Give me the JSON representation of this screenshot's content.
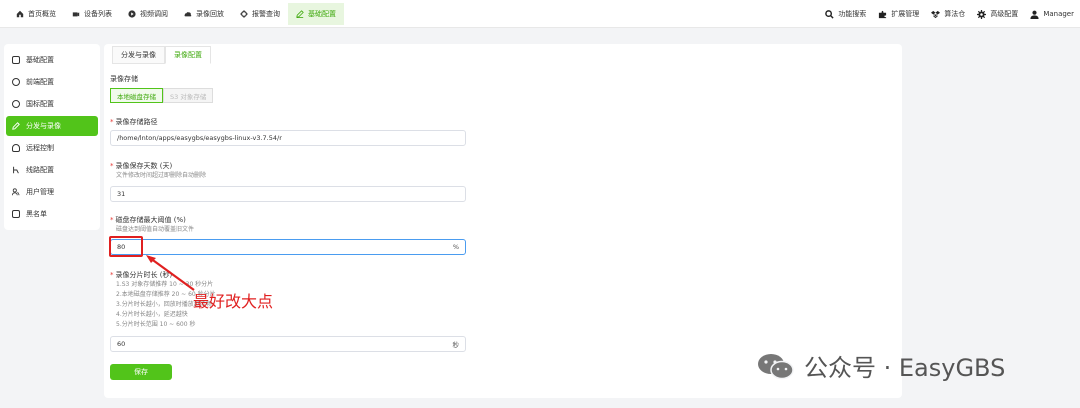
{
  "topnav": {
    "items": [
      {
        "label": "首页概览",
        "icon": "home-icon"
      },
      {
        "label": "设备列表",
        "icon": "camera-icon"
      },
      {
        "label": "视频调阅",
        "icon": "play-circle-icon"
      },
      {
        "label": "录像回放",
        "icon": "cloud-icon"
      },
      {
        "label": "报警查询",
        "icon": "gear-alarm-icon"
      },
      {
        "label": "基础配置",
        "icon": "edit-icon",
        "active": true
      }
    ],
    "tools": [
      {
        "label": "功能搜索",
        "icon": "search-icon"
      },
      {
        "label": "扩展管理",
        "icon": "puzzle-icon"
      },
      {
        "label": "算法仓",
        "icon": "dropbox-icon"
      },
      {
        "label": "高级配置",
        "icon": "gear-icon"
      },
      {
        "label": "Manager",
        "icon": "user-icon"
      }
    ]
  },
  "sidebar": {
    "items": [
      {
        "label": "基础配置"
      },
      {
        "label": "前端配置"
      },
      {
        "label": "国标配置"
      },
      {
        "label": "分发与录像",
        "active": true
      },
      {
        "label": "远程控制"
      },
      {
        "label": "线路配置"
      },
      {
        "label": "用户管理"
      },
      {
        "label": "黑名单"
      }
    ]
  },
  "tabs": [
    {
      "label": "分发与录像"
    },
    {
      "label": "录像配置",
      "active": true
    }
  ],
  "form": {
    "storage_section": "录像存储",
    "storage_options": [
      "本地磁盘存储",
      "S3 对象存储"
    ],
    "path_label": "录像存储路径",
    "path_value": "/home/lnton/apps/easygbs/easygbs-linux-v3.7.54/r",
    "days_label": "录像保存天数 (天)",
    "days_hint": "文件修改时间超过即删除自动删除",
    "days_value": "31",
    "disk_label": "磁盘存储最大阈值 (%)",
    "disk_hint": "磁盘达到阈值自动覆盖旧文件",
    "disk_value": "80",
    "disk_suffix": "%",
    "slice_label": "录像分片时长 (秒)",
    "slice_hints": [
      "1.S3 对象存储推荐 10 ~ 30 秒分片",
      "2.本地磁盘存储推荐 20 ~ 60 秒分片",
      "3.分片时长越小，回放时播放越流畅",
      "4.分片时长越小，延迟越快",
      "5.分片时长范围 10 ~ 600 秒"
    ],
    "slice_value": "60",
    "slice_suffix": "秒",
    "save_label": "保存"
  },
  "annotation": {
    "text": "最好改大点",
    "color": "#e02020"
  },
  "watermark": {
    "text": "公众号 · EasyGBS"
  },
  "colors": {
    "accent": "#52c41a",
    "accent_text": "#3fa90d",
    "focus": "#4a9cf0"
  }
}
